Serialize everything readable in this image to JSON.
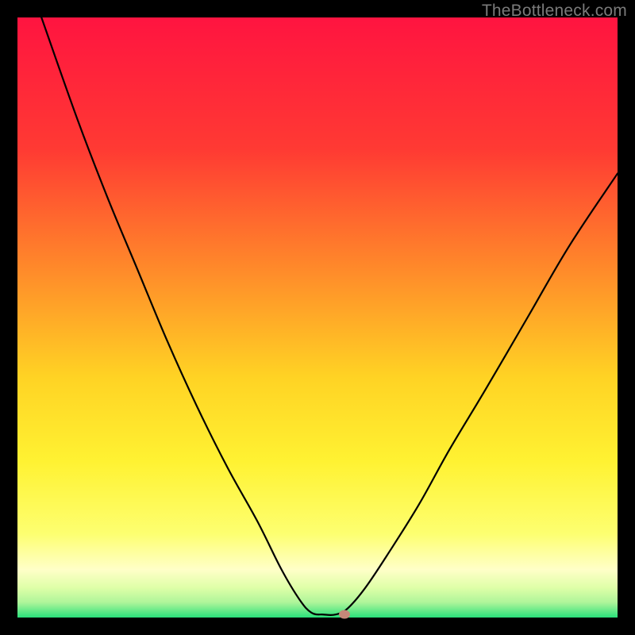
{
  "watermark": "TheBottleneck.com",
  "chart_data": {
    "type": "line",
    "title": "",
    "xlabel": "",
    "ylabel": "",
    "xlim": [
      0,
      100
    ],
    "ylim": [
      0,
      100
    ],
    "grid": false,
    "legend": false,
    "curve": [
      {
        "x": 4,
        "y": 100
      },
      {
        "x": 10,
        "y": 83
      },
      {
        "x": 15,
        "y": 70
      },
      {
        "x": 20,
        "y": 58
      },
      {
        "x": 25,
        "y": 46
      },
      {
        "x": 30,
        "y": 35
      },
      {
        "x": 35,
        "y": 25
      },
      {
        "x": 40,
        "y": 16
      },
      {
        "x": 44,
        "y": 8
      },
      {
        "x": 47,
        "y": 3
      },
      {
        "x": 49,
        "y": 0.8
      },
      {
        "x": 51,
        "y": 0.5
      },
      {
        "x": 53,
        "y": 0.5
      },
      {
        "x": 55,
        "y": 1.5
      },
      {
        "x": 58,
        "y": 5
      },
      {
        "x": 62,
        "y": 11
      },
      {
        "x": 67,
        "y": 19
      },
      {
        "x": 72,
        "y": 28
      },
      {
        "x": 78,
        "y": 38
      },
      {
        "x": 85,
        "y": 50
      },
      {
        "x": 92,
        "y": 62
      },
      {
        "x": 100,
        "y": 74
      }
    ],
    "marker": {
      "x": 54.5,
      "y": 0.5
    },
    "background_gradient": {
      "stops": [
        {
          "t": 0.0,
          "color": "#ff1440"
        },
        {
          "t": 0.22,
          "color": "#ff3a33"
        },
        {
          "t": 0.42,
          "color": "#ff8a2a"
        },
        {
          "t": 0.6,
          "color": "#ffd324"
        },
        {
          "t": 0.74,
          "color": "#fff232"
        },
        {
          "t": 0.86,
          "color": "#fdff70"
        },
        {
          "t": 0.92,
          "color": "#ffffc8"
        },
        {
          "t": 0.95,
          "color": "#dfffa8"
        },
        {
          "t": 0.975,
          "color": "#aef59a"
        },
        {
          "t": 1.0,
          "color": "#29e07a"
        }
      ]
    }
  }
}
